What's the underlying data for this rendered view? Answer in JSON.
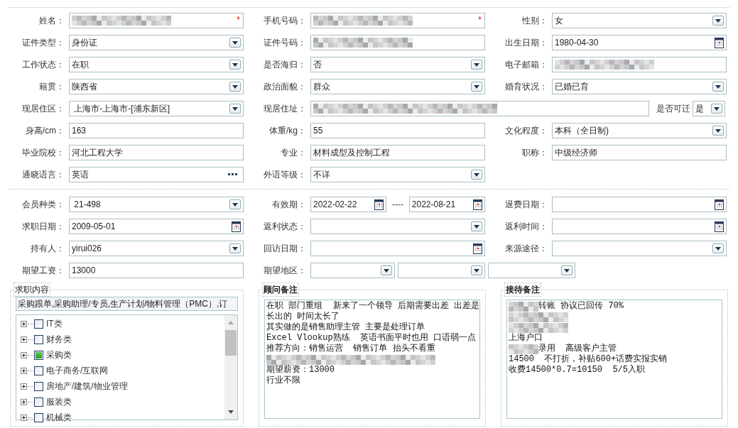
{
  "personal_rows": [
    [
      {
        "label": "姓名：",
        "kind": "blurred",
        "required_mark": "*"
      },
      {
        "label": "手机号码：",
        "kind": "blurred",
        "required_mark": "*"
      },
      {
        "label": "性别：",
        "kind": "select",
        "value": "女"
      }
    ],
    [
      {
        "label": "证件类型：",
        "kind": "select",
        "value": "身份证"
      },
      {
        "label": "证件号码：",
        "kind": "blurred"
      },
      {
        "label": "出生日期：",
        "kind": "date",
        "value": "1980-04-30"
      }
    ],
    [
      {
        "label": "工作状态：",
        "kind": "select",
        "value": "在职"
      },
      {
        "label": "是否海归：",
        "kind": "select",
        "value": "否"
      },
      {
        "label": "电子邮箱：",
        "kind": "blurred"
      }
    ],
    [
      {
        "label": "籍贯：",
        "kind": "select",
        "value": "陕西省"
      },
      {
        "label": "政治面貌：",
        "kind": "select",
        "value": "群众"
      },
      {
        "label": "婚育状况：",
        "kind": "select",
        "value": "已婚已育"
      }
    ],
    [
      {
        "label": "现居住区：",
        "kind": "select",
        "value": " 上海市-上海市-[浦东新区]"
      },
      {
        "label": "现居住址：",
        "kind": "blurred",
        "extra": {
          "label": "是否可迁",
          "kind": "select",
          "value": "是"
        }
      }
    ],
    [
      {
        "label": "身高/cm：",
        "kind": "text",
        "value": "163"
      },
      {
        "label": "体重/kg：",
        "kind": "text",
        "value": "55"
      },
      {
        "label": "文化程度：",
        "kind": "select",
        "value": "本科（全日制)"
      }
    ],
    [
      {
        "label": "毕业院校：",
        "kind": "text",
        "value": "河北工程大学"
      },
      {
        "label": "专业：",
        "kind": "text",
        "value": "材料成型及控制工程"
      },
      {
        "label": "职称：",
        "kind": "text",
        "value": "中级经济师"
      }
    ],
    [
      {
        "label": "通晓语言：",
        "kind": "lookup",
        "value": "英语"
      },
      {
        "label": "外语等级：",
        "kind": "select",
        "value": "不详"
      }
    ]
  ],
  "member_rows": [
    [
      {
        "label": "会员种类：",
        "kind": "select",
        "value": " 21-498"
      },
      {
        "label": "有效期：",
        "kind": "range",
        "from": "2022-02-22",
        "separator": "----",
        "to": "2022-08-21"
      },
      {
        "label": "退费日期：",
        "kind": "date"
      }
    ],
    [
      {
        "label": "求职日期：",
        "kind": "date",
        "value": "2009-05-01"
      },
      {
        "label": "返利状态：",
        "kind": "select"
      },
      {
        "label": "返利时间：",
        "kind": "date"
      }
    ],
    [
      {
        "label": "持有人：",
        "kind": "select",
        "value": "yirui026"
      },
      {
        "label": "回访日期：",
        "kind": "date"
      },
      {
        "label": "来源途径：",
        "kind": "select"
      }
    ],
    [
      {
        "label": "期望工资：",
        "kind": "text",
        "value": "13000"
      },
      {
        "label": "期望地区：",
        "kind": "region"
      }
    ]
  ],
  "job_intent": {
    "title": "求职内容",
    "summary": "采购跟单,采购助理/专员,生产计划/物料管理（PMC）,订",
    "tree": [
      {
        "label": "IT类",
        "checked": false,
        "expanded": false
      },
      {
        "label": "财务类",
        "checked": false,
        "expanded": false
      },
      {
        "label": "采购类",
        "checked": true,
        "expanded": false
      },
      {
        "label": "电子商务/互联网",
        "checked": false,
        "expanded": false
      },
      {
        "label": "房地产/建筑/物业管理",
        "checked": false,
        "expanded": false
      },
      {
        "label": "服装类",
        "checked": false,
        "expanded": false
      },
      {
        "label": "机械类",
        "checked": false,
        "expanded": false
      }
    ]
  },
  "notes": [
    {
      "title": "顾问备注",
      "lines": [
        {
          "kind": "text",
          "text": "在职 部门重组  新来了一个领导 后期需要出差 出差是"
        },
        {
          "kind": "text",
          "text": "长出的 时间太长了"
        },
        {
          "kind": "text",
          "text": "其实做的是销售助理主管 主要是处理订单"
        },
        {
          "kind": "text",
          "text": "Excel Vlookup熟练  英语书面平时也用 口语弱一点"
        },
        {
          "kind": "text",
          "text": "推荐方向：销售运营  销售订单 抬头不看重"
        },
        {
          "kind": "blurred"
        },
        {
          "kind": "text",
          "text": "期望薪资：13000"
        },
        {
          "kind": "text",
          "text": "行业不限"
        }
      ]
    },
    {
      "title": "接待备注",
      "lines": [
        {
          "kind": "prefixed",
          "text": "转账 协议已回传 70%"
        },
        {
          "kind": "blurred"
        },
        {
          "kind": "blurred"
        },
        {
          "kind": "text",
          "text": "上海户口"
        },
        {
          "kind": "prefixed",
          "text": "录用  高级客户主管"
        },
        {
          "kind": "text",
          "text": "14500  不打折，补贴600+话费实报实销"
        },
        {
          "kind": "text",
          "text": "收费14500*0.7=10150  5/5入职"
        }
      ]
    }
  ]
}
